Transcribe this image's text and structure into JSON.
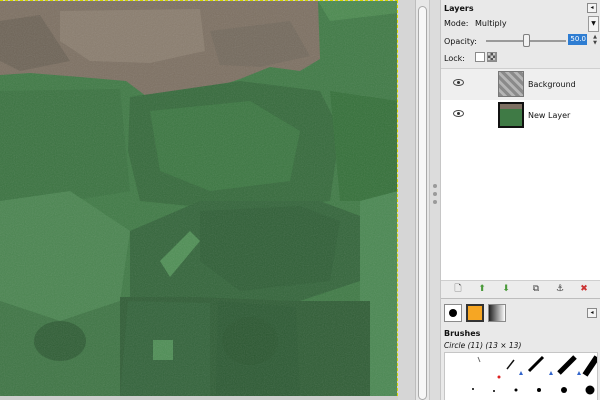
{
  "layers_panel": {
    "title": "Layers",
    "mode_label": "Mode:",
    "mode_value": "Multiply",
    "opacity_label": "Opacity:",
    "opacity_value": "50.0",
    "opacity_fraction": 0.5,
    "lock_label": "Lock:",
    "layers": [
      {
        "name": "Background",
        "visible": true,
        "selected": true
      },
      {
        "name": "New Layer",
        "visible": true,
        "selected": false
      }
    ]
  },
  "brushes_panel": {
    "title": "Brushes",
    "brush_name": "Circle (11) (13 × 13)"
  },
  "colors": {
    "accent": "#2e7dd2",
    "grass": "#3f7a45",
    "rock": "#7d7062",
    "selection": "#d8d800"
  },
  "icons": [
    "eye-icon",
    "new-layer-icon",
    "raise-layer-icon",
    "lower-layer-icon",
    "duplicate-layer-icon",
    "anchor-icon",
    "delete-layer-icon"
  ]
}
